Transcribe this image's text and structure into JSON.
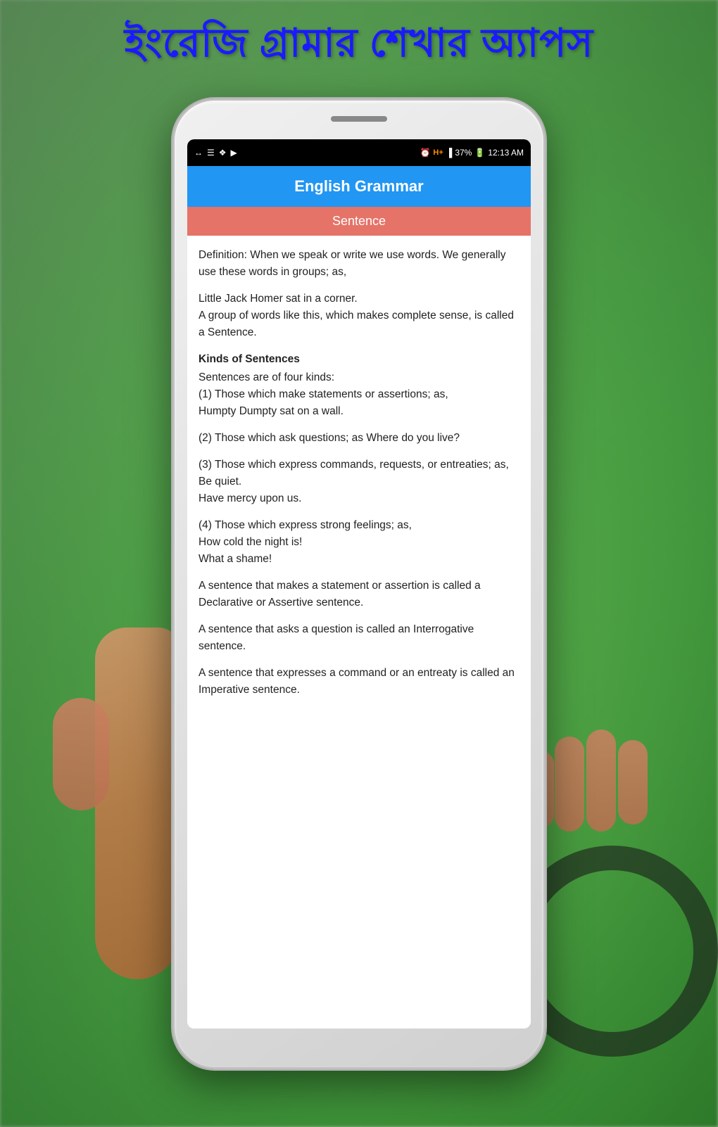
{
  "page": {
    "background_colors": [
      "#a8d5a2",
      "#5db85a",
      "#2a852a"
    ],
    "bengali_title": "ইংরেজি গ্রামার শেখার অ্যাপস"
  },
  "status_bar": {
    "time": "12:13 AM",
    "battery_percent": "37%",
    "signal_type": "H+",
    "icons_left": [
      "←→",
      "☰",
      "❖",
      "▶"
    ]
  },
  "app_header": {
    "title": "English Grammar",
    "background_color": "#2196F3"
  },
  "sub_header": {
    "text": "Sentence",
    "background_color": "#E57368"
  },
  "content": {
    "paragraphs": [
      {
        "type": "normal",
        "text": "Definition: When we speak or write we use words. We generally use these words in groups; as,"
      },
      {
        "type": "normal",
        "text": "Little Jack Homer sat in a corner.\nA group of words like this, which makes complete sense, is called a Sentence."
      },
      {
        "type": "bold",
        "text": "Kinds of Sentences"
      },
      {
        "type": "normal",
        "text": "Sentences are of four kinds:\n(1) Those which make statements or assertions; as,\nHumpty Dumpty sat on a wall."
      },
      {
        "type": "normal",
        "text": "(2) Those which ask questions; as Where do you live?"
      },
      {
        "type": "normal",
        "text": "(3) Those which express commands, requests, or entreaties; as,\nBe quiet.\nHave mercy upon us."
      },
      {
        "type": "normal",
        "text": "(4) Those which express strong feelings; as,\nHow cold the night is!\nWhat a shame!"
      },
      {
        "type": "normal",
        "text": "A sentence that makes a statement or assertion is called a Declarative or Assertive sentence."
      },
      {
        "type": "normal",
        "text": "A sentence that asks a question is called an Interrogative sentence."
      },
      {
        "type": "normal",
        "text": "A sentence that expresses a command or an entreaty is called an Imperative sentence."
      }
    ]
  }
}
